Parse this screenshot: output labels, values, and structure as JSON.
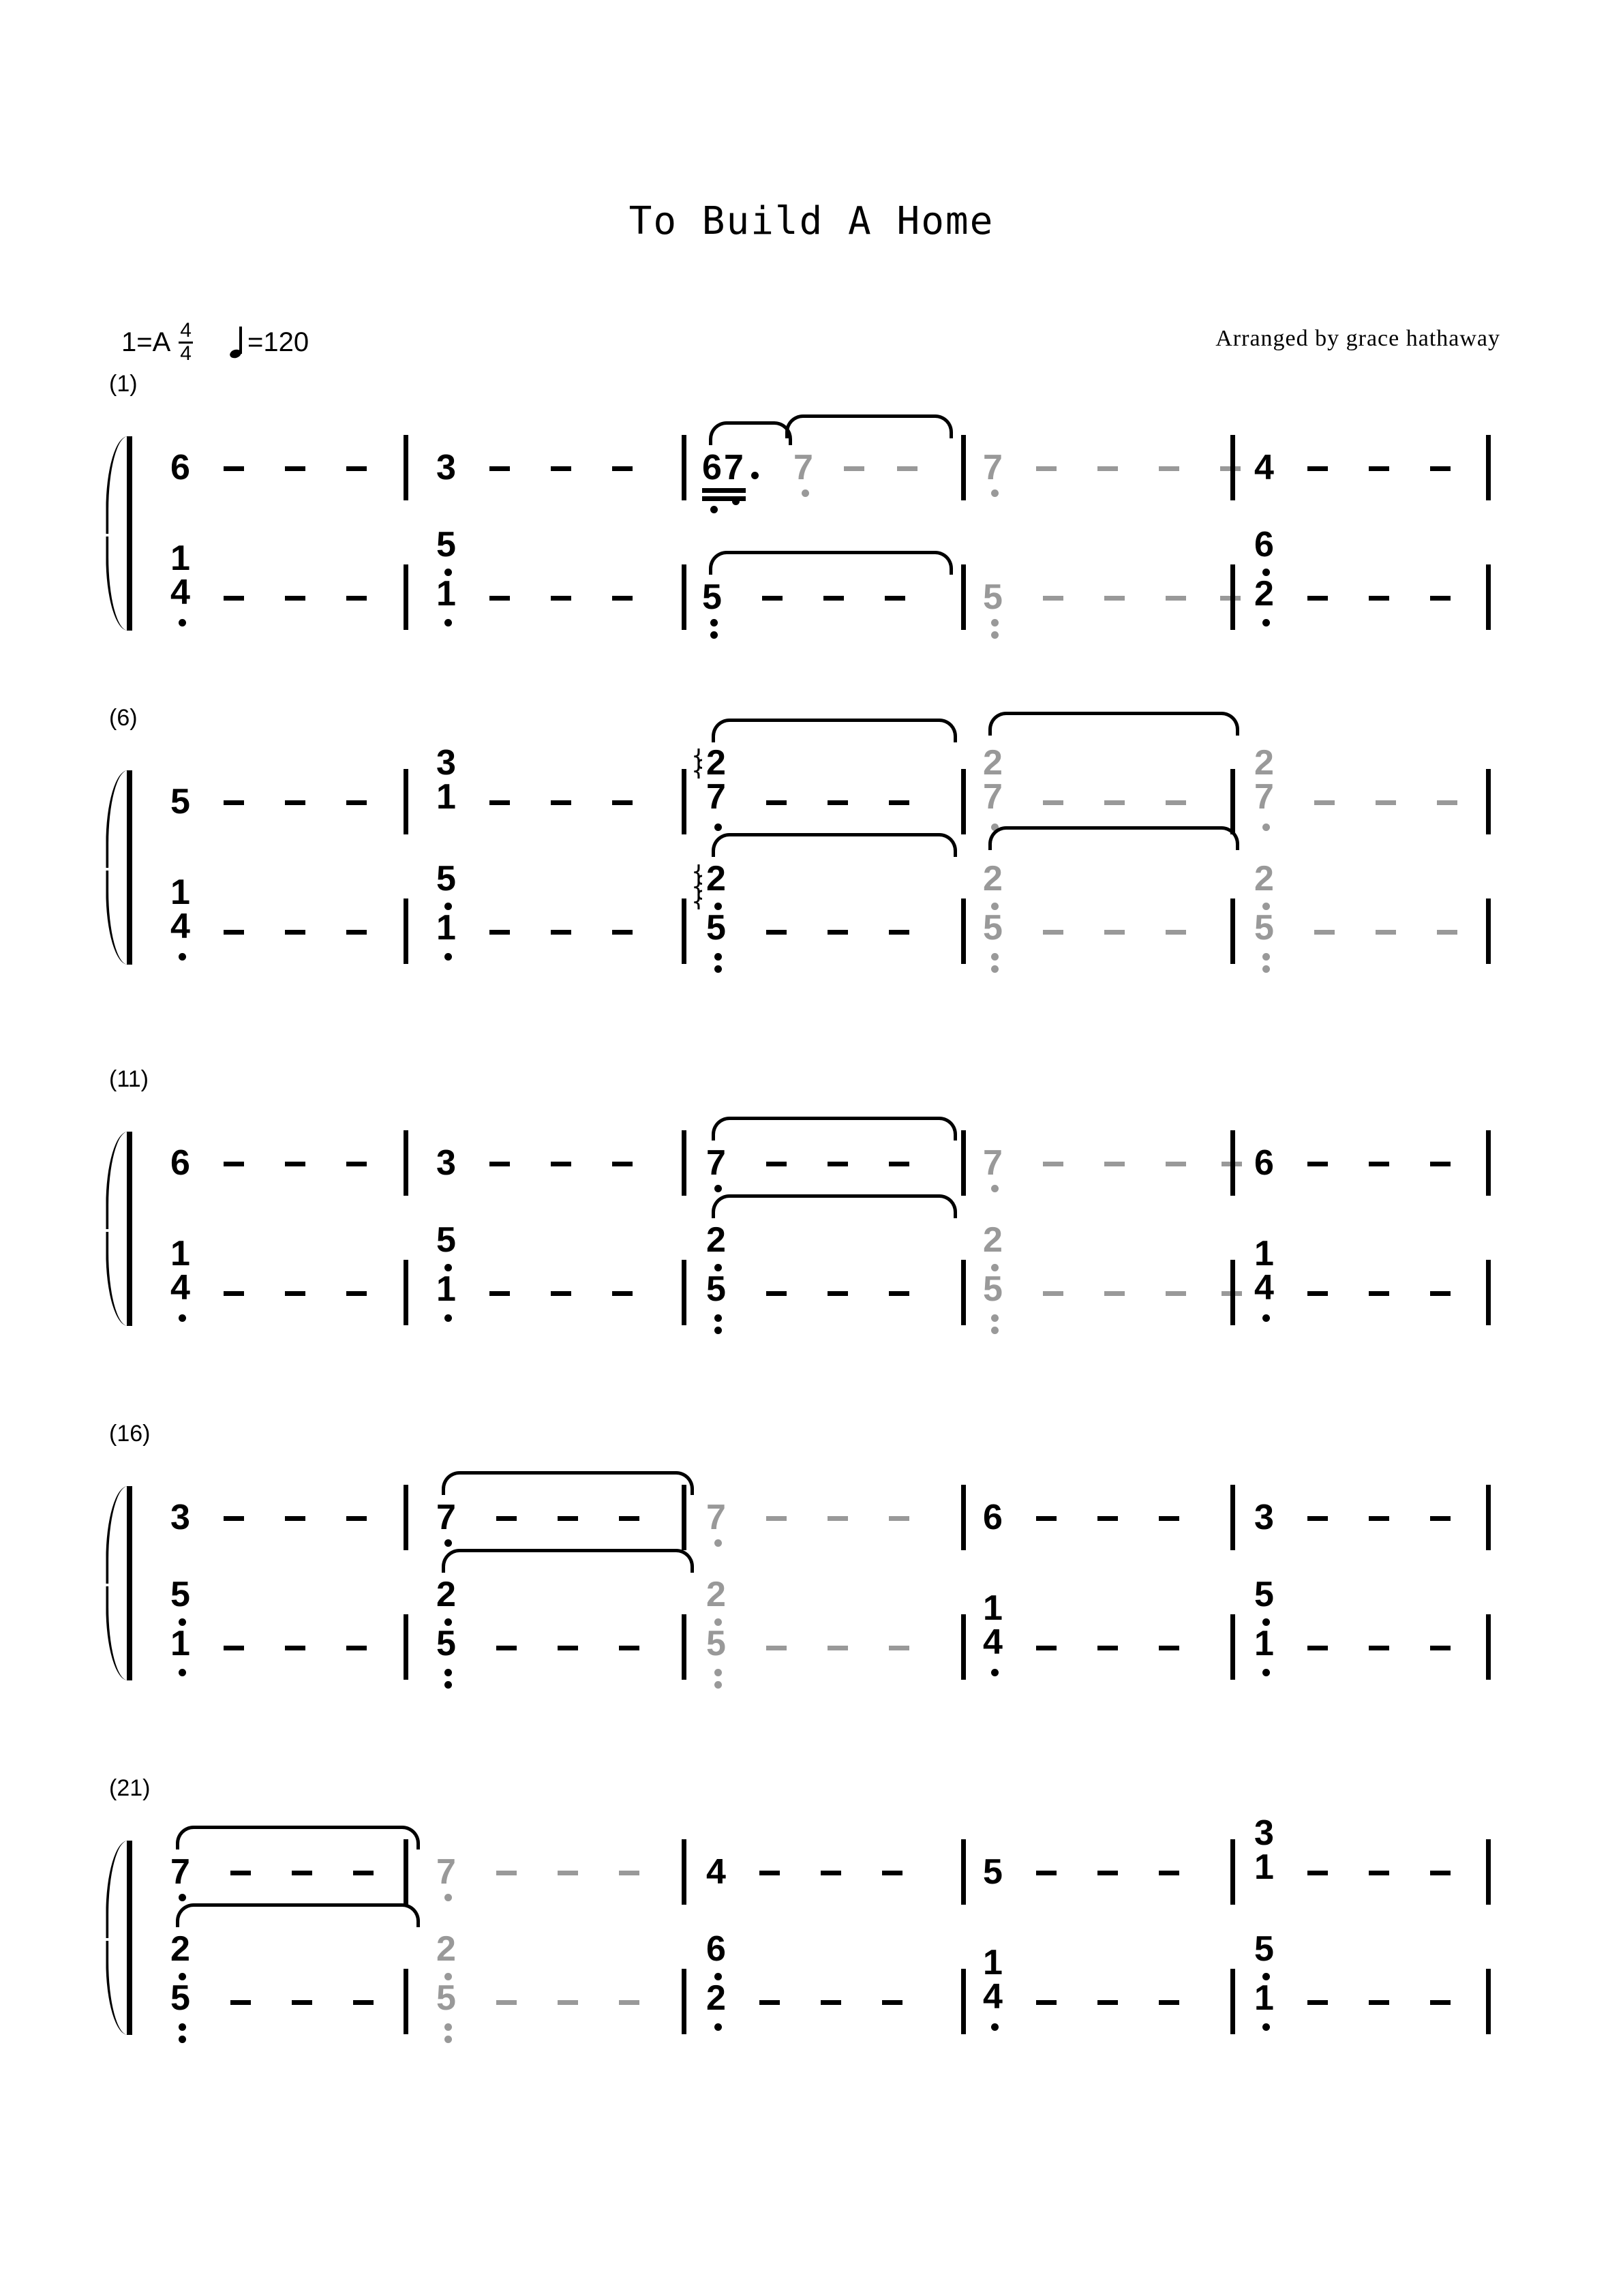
{
  "header": {
    "title": "To Build A Home",
    "key_label": "1=A",
    "time_num": "4",
    "time_den": "4",
    "tempo_eq": "=120",
    "tempo_note": "quarter-note",
    "arranger": "Arranged by grace hathaway"
  },
  "notation": {
    "grey_color": "#999999",
    "black_color": "#000000",
    "dash_glyph": "-",
    "style": "jianpu-numbered-notation"
  },
  "systems": [
    {
      "number_label": "(1)",
      "measures": [
        {
          "index": "1",
          "upper": {
            "notes": [
              "6"
            ],
            "dashes": 3
          },
          "lower": {
            "chord": [
              "1",
              "4"
            ],
            "dots_below": [
              "0",
              "1"
            ],
            "dashes": 3
          }
        },
        {
          "index": "2",
          "upper": {
            "notes": [
              "3"
            ],
            "dashes": 3
          },
          "lower": {
            "chord": [
              "5",
              "1"
            ],
            "dots_below": [
              "1",
              "1"
            ],
            "dashes": 3
          }
        },
        {
          "index": "3",
          "upper": {
            "notes": [
              "6",
              "7"
            ],
            "beamed": "true",
            "aug_dot": "true",
            "dots_below": [
              "1",
              "1"
            ],
            "tied_note": "7",
            "tied_dots_below": [
              "1"
            ],
            "dashes": 2
          },
          "lower": {
            "notes": [
              "5"
            ],
            "dots_below": [
              "2"
            ],
            "dashes": 3
          }
        },
        {
          "index": "4",
          "upper": {
            "notes": [
              "7"
            ],
            "grey": "true",
            "dots_below": [
              "1"
            ],
            "dashes": 4
          },
          "lower": {
            "notes": [
              "5"
            ],
            "grey": "true",
            "dots_below": [
              "2"
            ],
            "dashes": 4
          }
        },
        {
          "index": "5",
          "upper": {
            "notes": [
              "4"
            ],
            "dashes": 3
          },
          "lower": {
            "chord": [
              "6",
              "2"
            ],
            "dots_below": [
              "1",
              "1"
            ],
            "dashes": 3
          }
        }
      ]
    },
    {
      "number_label": "(6)",
      "measures": [
        {
          "index": "6",
          "upper": {
            "notes": [
              "5"
            ],
            "dashes": 3
          },
          "lower": {
            "chord": [
              "1",
              "4"
            ],
            "dots_below": [
              "0",
              "1"
            ],
            "dashes": 3
          }
        },
        {
          "index": "7",
          "upper": {
            "chord": [
              "3",
              "1"
            ],
            "dashes": 3
          },
          "lower": {
            "chord": [
              "5",
              "1"
            ],
            "dots_below": [
              "1",
              "1"
            ],
            "dashes": 3
          }
        },
        {
          "index": "8",
          "upper": {
            "chord": [
              "2",
              "7"
            ],
            "dots_below": [
              "0",
              "1"
            ],
            "arpeggio": "true",
            "dashes": 3
          },
          "lower": {
            "chord": [
              "2",
              "5"
            ],
            "dots_below": [
              "1",
              "2"
            ],
            "arpeggio": "true",
            "dashes": 3
          }
        },
        {
          "index": "9",
          "upper": {
            "chord": [
              "2",
              "7"
            ],
            "grey": "true",
            "dots_below": [
              "0",
              "1"
            ],
            "dashes": 3
          },
          "lower": {
            "chord": [
              "2",
              "5"
            ],
            "grey": "true",
            "dots_below": [
              "1",
              "2"
            ],
            "dashes": 3
          }
        },
        {
          "index": "10",
          "upper": {
            "chord": [
              "2",
              "7"
            ],
            "grey": "true",
            "dots_below": [
              "0",
              "1"
            ],
            "dashes": 3
          },
          "lower": {
            "chord": [
              "2",
              "5"
            ],
            "grey": "true",
            "dots_below": [
              "1",
              "2"
            ],
            "dashes": 3
          }
        }
      ]
    },
    {
      "number_label": "(11)",
      "measures": [
        {
          "index": "11",
          "upper": {
            "notes": [
              "6"
            ],
            "dashes": 3
          },
          "lower": {
            "chord": [
              "1",
              "4"
            ],
            "dots_below": [
              "0",
              "1"
            ],
            "dashes": 3
          }
        },
        {
          "index": "12",
          "upper": {
            "notes": [
              "3"
            ],
            "dashes": 3
          },
          "lower": {
            "chord": [
              "5",
              "1"
            ],
            "dots_below": [
              "1",
              "1"
            ],
            "dashes": 3
          }
        },
        {
          "index": "13",
          "upper": {
            "notes": [
              "7"
            ],
            "dots_below": [
              "1"
            ],
            "dashes": 3
          },
          "lower": {
            "chord": [
              "2",
              "5"
            ],
            "dots_below": [
              "1",
              "2"
            ],
            "dashes": 3
          }
        },
        {
          "index": "14",
          "upper": {
            "notes": [
              "7"
            ],
            "grey": "true",
            "dots_below": [
              "1"
            ],
            "dashes": 4
          },
          "lower": {
            "chord": [
              "2",
              "5"
            ],
            "grey": "true",
            "dots_below": [
              "1",
              "2"
            ],
            "dashes": 4
          }
        },
        {
          "index": "15",
          "upper": {
            "notes": [
              "6"
            ],
            "dashes": 3
          },
          "lower": {
            "chord": [
              "1",
              "4"
            ],
            "dots_below": [
              "0",
              "1"
            ],
            "dashes": 3
          }
        }
      ]
    },
    {
      "number_label": "(16)",
      "measures": [
        {
          "index": "16",
          "upper": {
            "notes": [
              "3"
            ],
            "dashes": 3
          },
          "lower": {
            "chord": [
              "5",
              "1"
            ],
            "dots_below": [
              "1",
              "1"
            ],
            "dashes": 3
          }
        },
        {
          "index": "17",
          "upper": {
            "notes": [
              "7"
            ],
            "dots_below": [
              "1"
            ],
            "dashes": 3
          },
          "lower": {
            "chord": [
              "2",
              "5"
            ],
            "dots_below": [
              "1",
              "2"
            ],
            "dashes": 3
          }
        },
        {
          "index": "18",
          "upper": {
            "notes": [
              "7"
            ],
            "grey": "true",
            "dots_below": [
              "1"
            ],
            "dashes": 3
          },
          "lower": {
            "chord": [
              "2",
              "5"
            ],
            "grey": "true",
            "dots_below": [
              "1",
              "2"
            ],
            "dashes": 3
          }
        },
        {
          "index": "19",
          "upper": {
            "notes": [
              "6"
            ],
            "dashes": 3
          },
          "lower": {
            "chord": [
              "1",
              "4"
            ],
            "dots_below": [
              "0",
              "1"
            ],
            "dashes": 3
          }
        },
        {
          "index": "20",
          "upper": {
            "notes": [
              "3"
            ],
            "dashes": 3
          },
          "lower": {
            "chord": [
              "5",
              "1"
            ],
            "dots_below": [
              "1",
              "1"
            ],
            "dashes": 3
          }
        }
      ]
    },
    {
      "number_label": "(21)",
      "measures": [
        {
          "index": "21",
          "upper": {
            "notes": [
              "7"
            ],
            "dots_below": [
              "1"
            ],
            "dashes": 3
          },
          "lower": {
            "chord": [
              "2",
              "5"
            ],
            "dots_below": [
              "1",
              "2"
            ],
            "dashes": 3
          }
        },
        {
          "index": "22",
          "upper": {
            "notes": [
              "7"
            ],
            "grey": "true",
            "dots_below": [
              "1"
            ],
            "dashes": 3
          },
          "lower": {
            "chord": [
              "2",
              "5"
            ],
            "grey": "true",
            "dots_below": [
              "1",
              "2"
            ],
            "dashes": 3
          }
        },
        {
          "index": "23",
          "upper": {
            "notes": [
              "4"
            ],
            "dashes": 3
          },
          "lower": {
            "chord": [
              "6",
              "2"
            ],
            "dots_below": [
              "1",
              "1"
            ],
            "dashes": 3
          }
        },
        {
          "index": "24",
          "upper": {
            "notes": [
              "5"
            ],
            "dashes": 3
          },
          "lower": {
            "chord": [
              "1",
              "4"
            ],
            "dots_below": [
              "0",
              "1"
            ],
            "dashes": 3
          }
        },
        {
          "index": "25",
          "upper": {
            "chord": [
              "3",
              "1"
            ],
            "dashes": 3
          },
          "lower": {
            "chord": [
              "5",
              "1"
            ],
            "dots_below": [
              "1",
              "1"
            ],
            "dashes": 3
          }
        }
      ]
    }
  ]
}
